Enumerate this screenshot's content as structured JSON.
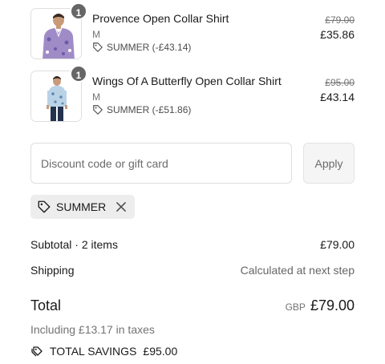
{
  "items": [
    {
      "quantity": "1",
      "name": "Provence Open Collar Shirt",
      "variant": "M",
      "discount": "SUMMER (-£43.14)",
      "price_original": "£79.00",
      "price_final": "£35.86",
      "image": "shirt-photo-purple-floral",
      "image_colors": {
        "bg": "#ffffff",
        "shirt": "#9f8cc7",
        "accent": "#6b5ba8",
        "skin": "#c89a7a",
        "hair": "#3a2a22",
        "pants": "#2b3240"
      }
    },
    {
      "quantity": "1",
      "name": "Wings Of A Butterfly Open Collar Shirt",
      "variant": "M",
      "discount": "SUMMER (-£51.86)",
      "price_original": "£95.00",
      "price_final": "£43.14",
      "image": "shirt-photo-blue-butterfly",
      "image_colors": {
        "bg": "#ffffff",
        "shirt": "#b9d2e6",
        "accent": "#5d86ad",
        "skin": "#c79a7c",
        "hair": "#2c211b",
        "pants": "#23324d"
      }
    }
  ],
  "discount_form": {
    "placeholder": "Discount code or gift card",
    "apply_label": "Apply"
  },
  "applied_code": {
    "code": "SUMMER",
    "tag_icon": "tag-icon",
    "remove_icon": "close-icon"
  },
  "summary": {
    "subtotal_label": "Subtotal · 2 items",
    "subtotal_value": "£79.00",
    "shipping_label": "Shipping",
    "shipping_value": "Calculated at next step",
    "total_label": "Total",
    "currency": "GBP",
    "total_value": "£79.00",
    "taxes_note": "Including £13.17 in taxes",
    "savings_label": "TOTAL SAVINGS",
    "savings_value": "£95.00",
    "savings_icon": "tags-icon"
  },
  "colors": {
    "text": "#1a1a1a",
    "muted": "#737373",
    "border": "#dedede",
    "chip_bg": "#ededed",
    "badge_bg": "#666666"
  }
}
